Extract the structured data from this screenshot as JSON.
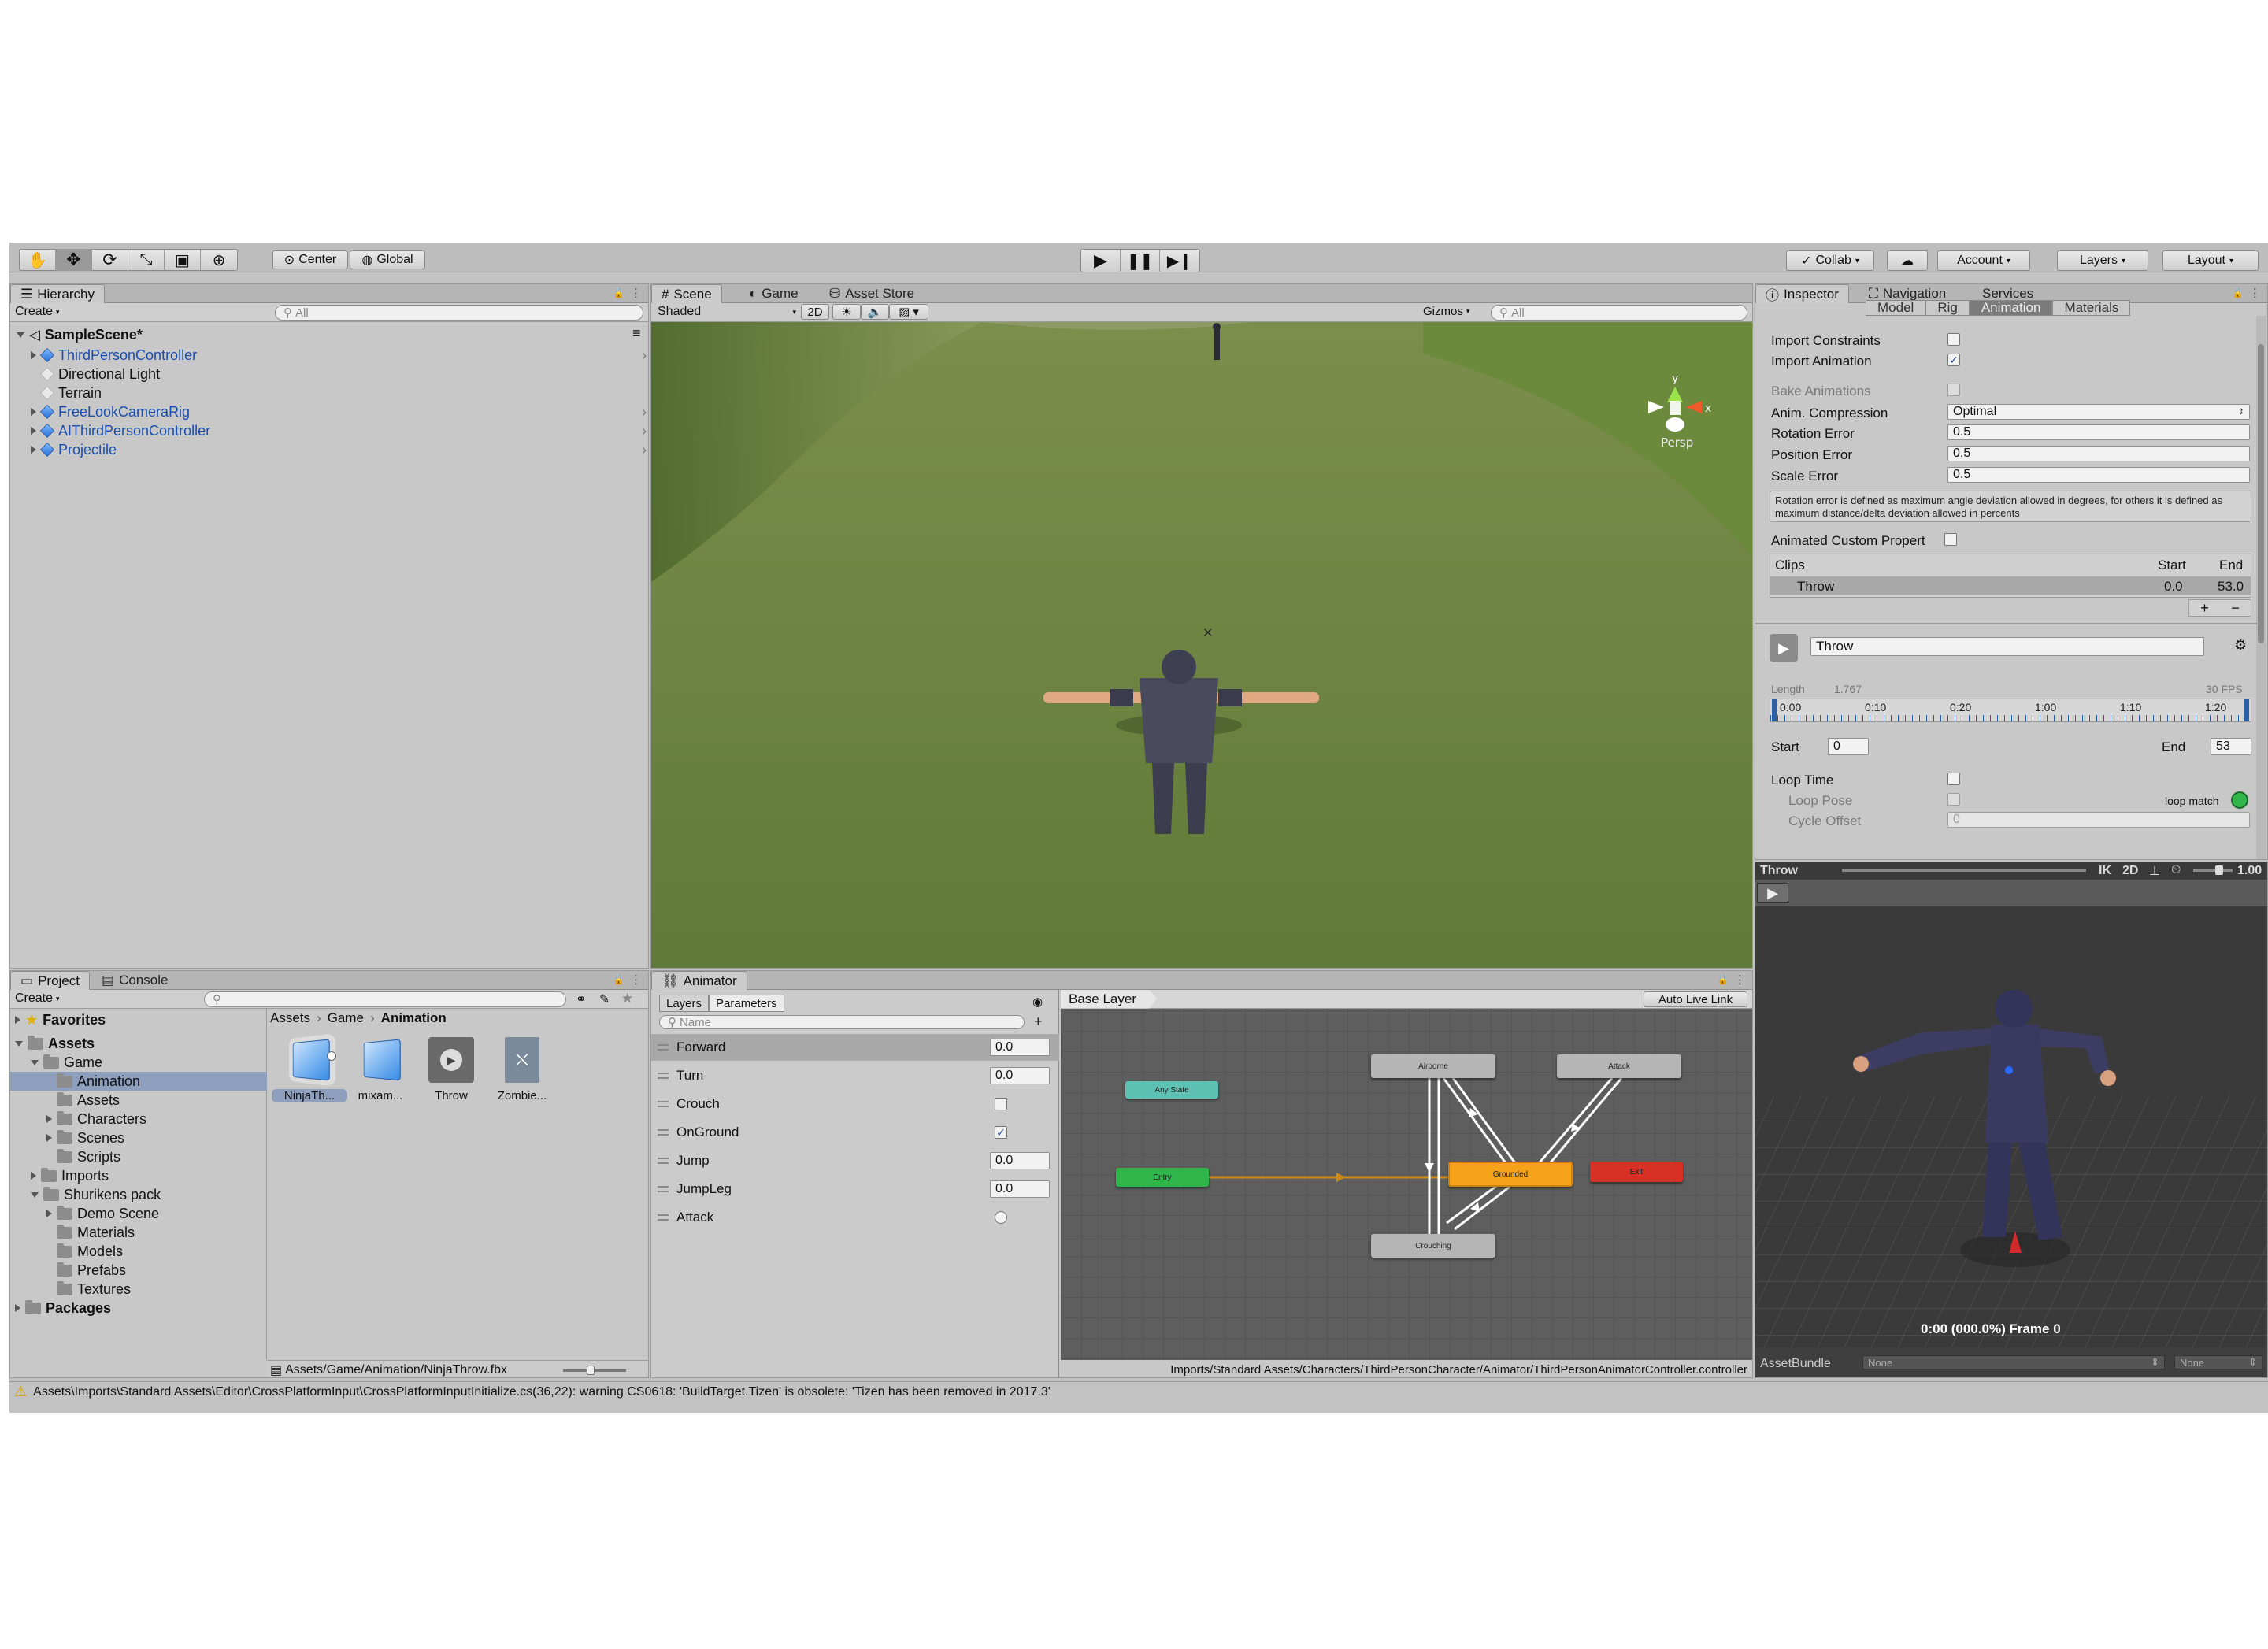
{
  "toolbar": {
    "pivot": "Center",
    "space": "Global",
    "collab": "Collab",
    "account": "Account",
    "layers": "Layers",
    "layout": "Layout"
  },
  "hierarchy": {
    "tab": "Hierarchy",
    "create": "Create",
    "search_placeholder": "All",
    "scene": "SampleScene*",
    "items": [
      {
        "label": "ThirdPersonController",
        "prefab": true,
        "expandable": true
      },
      {
        "label": "Directional Light",
        "prefab": false,
        "expandable": false
      },
      {
        "label": "Terrain",
        "prefab": false,
        "expandable": false
      },
      {
        "label": "FreeLookCameraRig",
        "prefab": true,
        "expandable": true
      },
      {
        "label": "AIThirdPersonController",
        "prefab": true,
        "expandable": true
      },
      {
        "label": "Projectile",
        "prefab": true,
        "expandable": true
      }
    ]
  },
  "scene_view": {
    "tabs": [
      "Scene",
      "Game",
      "Asset Store"
    ],
    "shading": "Shaded",
    "mode_2d": "2D",
    "gizmos": "Gizmos",
    "search_placeholder": "All",
    "gizmo_y": "y",
    "gizmo_x": "x",
    "projection": "Persp"
  },
  "inspector": {
    "tabs": [
      "Inspector",
      "Navigation",
      "Services"
    ],
    "import_tabs": [
      "Model",
      "Rig",
      "Animation",
      "Materials"
    ],
    "import_constraints_label": "Import Constraints",
    "import_animation_label": "Import Animation",
    "bake_animations_label": "Bake Animations",
    "anim_compression_label": "Anim. Compression",
    "anim_compression_value": "Optimal",
    "rotation_error_label": "Rotation Error",
    "rotation_error_value": "0.5",
    "position_error_label": "Position Error",
    "position_error_value": "0.5",
    "scale_error_label": "Scale Error",
    "scale_error_value": "0.5",
    "help_text": "Rotation error is defined as maximum angle deviation allowed in degrees, for others it is defined as maximum distance/delta deviation allowed in percents",
    "animated_custom_label": "Animated Custom Propert",
    "clips_header": "Clips",
    "start_header": "Start",
    "end_header": "End",
    "clip_name": "Throw",
    "clip_start": "0.0",
    "clip_end": "53.0",
    "plus": "+",
    "minus": "−",
    "clip_field": "Throw",
    "length_label": "Length",
    "length_value": "1.767",
    "fps": "30 FPS",
    "timeline_ticks": [
      "0:00",
      "0:10",
      "0:20",
      "1:00",
      "1:10",
      "1:20"
    ],
    "start_label": "Start",
    "start_value": "0",
    "end_label": "End",
    "end_value": "53",
    "loop_time_label": "Loop Time",
    "loop_pose_label": "Loop Pose",
    "loop_match_label": "loop match",
    "cycle_offset_label": "Cycle Offset",
    "cycle_offset_value": "0"
  },
  "preview": {
    "clip": "Throw",
    "ik": "IK",
    "mode_2d": "2D",
    "speed": "1.00",
    "frame_text": "0:00 (000.0%) Frame 0",
    "assetbundle_label": "AssetBundle",
    "assetbundle_value": "None",
    "variant_value": "None"
  },
  "project": {
    "tabs": [
      "Project",
      "Console"
    ],
    "create": "Create",
    "favorites": "Favorites",
    "tree": [
      {
        "label": "Assets",
        "depth": 0,
        "open": true,
        "bold": true
      },
      {
        "label": "Game",
        "depth": 1,
        "open": true
      },
      {
        "label": "Animation",
        "depth": 2,
        "selected": true
      },
      {
        "label": "Assets",
        "depth": 2
      },
      {
        "label": "Characters",
        "depth": 2,
        "expandable": true
      },
      {
        "label": "Scenes",
        "depth": 2,
        "expandable": true
      },
      {
        "label": "Scripts",
        "depth": 2
      },
      {
        "label": "Imports",
        "depth": 1,
        "expandable": true
      },
      {
        "label": "Shurikens pack",
        "depth": 1,
        "open": true
      },
      {
        "label": "Demo Scene",
        "depth": 2,
        "expandable": true
      },
      {
        "label": "Materials",
        "depth": 2
      },
      {
        "label": "Models",
        "depth": 2
      },
      {
        "label": "Prefabs",
        "depth": 2
      },
      {
        "label": "Textures",
        "depth": 2
      }
    ],
    "packages": "Packages",
    "breadcrumb": [
      "Assets",
      "Game",
      "Animation"
    ],
    "assets": [
      "NinjaTh...",
      "mixam...",
      "Throw",
      "Zombie..."
    ],
    "footer_path": "Assets/Game/Animation/NinjaThrow.fbx"
  },
  "animator": {
    "tab": "Animator",
    "subtabs": [
      "Layers",
      "Parameters"
    ],
    "search_placeholder": "Name",
    "params": [
      {
        "name": "Forward",
        "type": "float",
        "value": "0.0"
      },
      {
        "name": "Turn",
        "type": "float",
        "value": "0.0"
      },
      {
        "name": "Crouch",
        "type": "bool",
        "value": false
      },
      {
        "name": "OnGround",
        "type": "bool",
        "value": true
      },
      {
        "name": "Jump",
        "type": "float",
        "value": "0.0"
      },
      {
        "name": "JumpLeg",
        "type": "float",
        "value": "0.0"
      },
      {
        "name": "Attack",
        "type": "trigger",
        "value": false
      }
    ],
    "base_layer": "Base Layer",
    "auto_live_link": "Auto Live Link",
    "states": {
      "any_state": "Any State",
      "entry": "Entry",
      "grounded": "Grounded",
      "exit": "Exit",
      "airborne": "Airborne",
      "attack": "Attack",
      "crouching": "Crouching"
    },
    "footer_path": "Imports/Standard Assets/Characters/ThirdPersonCharacter/Animator/ThirdPersonAnimatorController.controller"
  },
  "status_bar": {
    "message": "Assets\\Imports\\Standard Assets\\Editor\\CrossPlatformInput\\CrossPlatformInputInitialize.cs(36,22): warning CS0618: 'BuildTarget.Tizen' is obsolete: 'Tizen has been removed in 2017.3'"
  },
  "colors": {
    "selection": "#8e9fbe",
    "prefab_text": "#1a4fb0",
    "entry_node": "#2fb54a",
    "grounded_node": "#f7a31a",
    "exit_node": "#d93026",
    "any_state_node": "#5fc1b4"
  }
}
